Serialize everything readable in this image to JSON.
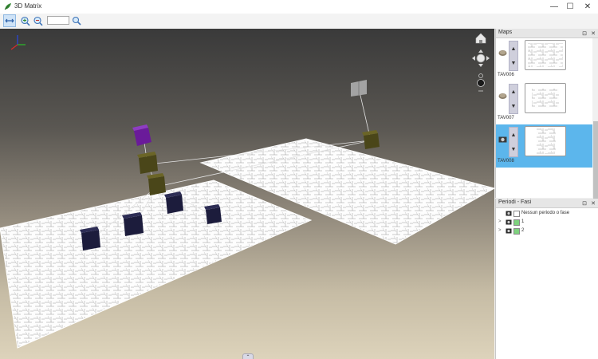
{
  "window": {
    "title": "3D Matrix",
    "icon": "app-leaf-icon",
    "minimize_glyph": "—",
    "maximize_glyph": "☐",
    "close_glyph": "✕"
  },
  "toolbar": {
    "tools": [
      {
        "name": "pan-tool",
        "icon": "double-arrow-icon",
        "active": true
      },
      {
        "name": "zoom-in-tool",
        "icon": "zoom-in-icon",
        "active": false
      },
      {
        "name": "zoom-out-tool",
        "icon": "zoom-out-icon",
        "active": false
      }
    ],
    "zoom_value": "",
    "search_icon": "magnifier-icon"
  },
  "viewport": {
    "nav_widgets": [
      "home-icon",
      "pan-compass-icon",
      "zoom-slider-icon"
    ],
    "bottom_tab_glyph": "⌃"
  },
  "maps_panel": {
    "title": "Maps",
    "pin_glyph": "⊡",
    "close_glyph": "✕",
    "items": [
      {
        "label": "TAV006",
        "selected": false,
        "up": "▲",
        "down": "▼"
      },
      {
        "label": "TAV007",
        "selected": false,
        "up": "▲",
        "down": "▼"
      },
      {
        "label": "TAV008",
        "selected": true,
        "up": "▲",
        "down": "▼"
      }
    ]
  },
  "periodi_panel": {
    "title": "Periodi - Fasi",
    "pin_glyph": "⊡",
    "close_glyph": "✕",
    "rows": [
      {
        "label": "Nessun periodo o fase",
        "expandable": false,
        "color": "#ffffff"
      },
      {
        "label": "1",
        "expandable": true,
        "color": "#7ed27e"
      },
      {
        "label": "2",
        "expandable": true,
        "color": "#7ed27e"
      }
    ]
  },
  "colors": {
    "accent_selected": "#5cb6ec",
    "node_purple": "#6a1b9a",
    "node_olive": "#4f4b1c",
    "node_navy": "#1c1c3c",
    "node_gray": "#9a9a9a"
  }
}
